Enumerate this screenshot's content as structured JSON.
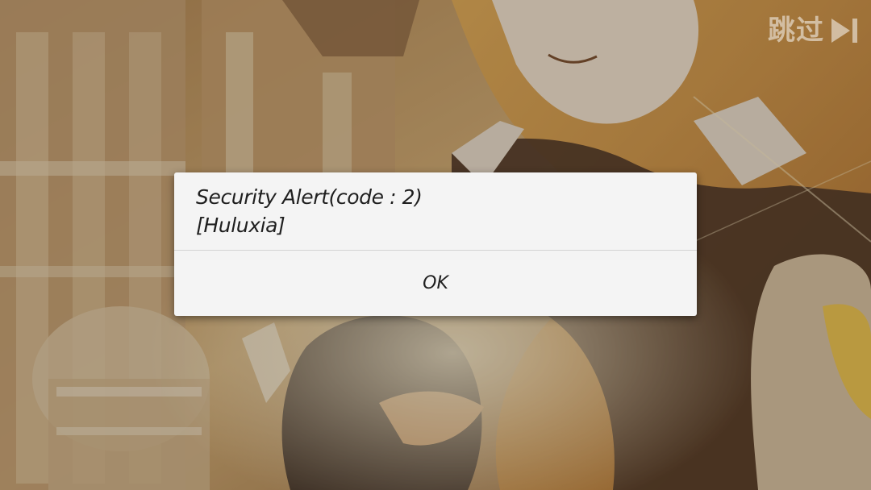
{
  "skip": {
    "label": "跳过",
    "icon": "skip-forward-icon"
  },
  "dialog": {
    "message_line1": "Security Alert(code : 2)",
    "message_line2": "[Huluxia]",
    "ok_label": "OK"
  },
  "colors": {
    "dialog_background": "#f4f4f4",
    "dialog_text": "#1f1f1f",
    "divider": "#d3d3d3",
    "skip_text": "#f1ebe3"
  }
}
